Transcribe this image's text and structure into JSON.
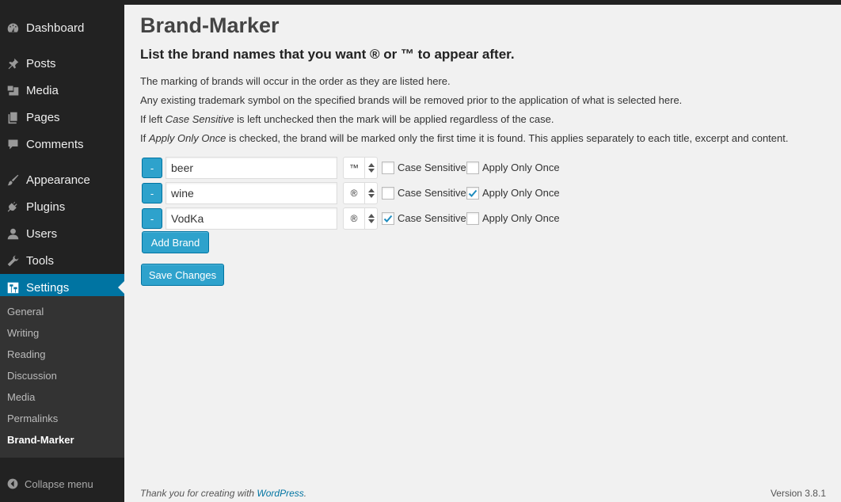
{
  "sidebar": {
    "items": [
      {
        "label": "Dashboard",
        "icon": "dashboard-icon"
      },
      {
        "label": "Posts",
        "icon": "pin-icon"
      },
      {
        "label": "Media",
        "icon": "media-icon"
      },
      {
        "label": "Pages",
        "icon": "pages-icon"
      },
      {
        "label": "Comments",
        "icon": "comment-icon"
      },
      {
        "label": "Appearance",
        "icon": "brush-icon"
      },
      {
        "label": "Plugins",
        "icon": "plug-icon"
      },
      {
        "label": "Users",
        "icon": "user-icon"
      },
      {
        "label": "Tools",
        "icon": "wrench-icon"
      },
      {
        "label": "Settings",
        "icon": "settings-icon",
        "active": true
      }
    ],
    "submenu": [
      "General",
      "Writing",
      "Reading",
      "Discussion",
      "Media",
      "Permalinks",
      "Brand-Marker"
    ],
    "current_submenu": "Brand-Marker",
    "collapse_label": "Collapse menu"
  },
  "page": {
    "title": "Brand-Marker",
    "subtitle": "List the brand names that you want ® or ™ to appear after.",
    "desc": {
      "line1": "The marking of brands will occur in the order as they are listed here.",
      "line2": "Any existing trademark symbol on the specified brands will be removed prior to the application of what is selected here.",
      "line3_pre": "If left ",
      "line3_em": "Case Sensitive",
      "line3_post": " is left unchecked then the mark will be applied regardless of the case.",
      "line4_pre": "If ",
      "line4_em": "Apply Only Once",
      "line4_post": " is checked, the brand will be marked only the first time it is found. This applies separately to each title, excerpt and content."
    }
  },
  "brands": [
    {
      "name": "beer",
      "mark": "™",
      "case_sensitive": false,
      "apply_once": false
    },
    {
      "name": "wine",
      "mark": "®",
      "case_sensitive": false,
      "apply_once": true
    },
    {
      "name": "VodKa",
      "mark": "®",
      "case_sensitive": true,
      "apply_once": false
    }
  ],
  "labels": {
    "remove": "-",
    "case_sensitive": "Case Sensitive",
    "apply_once": "Apply Only Once",
    "add_brand": "Add Brand",
    "save_changes": "Save Changes"
  },
  "footer": {
    "thanks_pre": "Thank you for creating with ",
    "thanks_link": "WordPress",
    "thanks_post": ".",
    "version": "Version 3.8.1"
  },
  "colors": {
    "accent": "#0074a2",
    "button": "#2ea2cc",
    "sidebar_bg": "#222222",
    "submenu_bg": "#333333"
  }
}
